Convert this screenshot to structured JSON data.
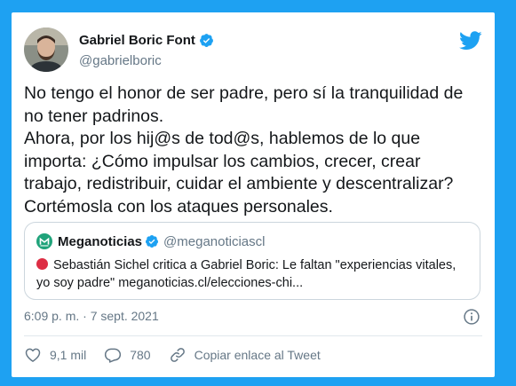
{
  "author": {
    "name": "Gabriel Boric Font",
    "handle": "@gabrielboric"
  },
  "tweet": {
    "lines": [
      "No tengo el honor de ser padre, pero sí la tranquilidad de",
      "no tener padrinos.",
      "Ahora, por los hij@s de tod@s, hablemos de lo que",
      "importa: ¿Cómo impulsar los cambios, crecer, crear",
      "trabajo, redistribuir, cuidar el ambiente y descentralizar?",
      "Cortémosla con los ataques personales."
    ]
  },
  "quote": {
    "name": "Meganoticias",
    "handle": "@meganoticiascl",
    "line1": "Sebastián Sichel critica a Gabriel Boric: Le faltan \"experiencias vitales,",
    "line2": "yo soy padre\" meganoticias.cl/elecciones-chi..."
  },
  "timestamp": "6:09 p. m. · 7 sept. 2021",
  "actions": {
    "likes": "9,1 mil",
    "replies": "780",
    "copy_link": "Copiar enlace al Tweet"
  },
  "colors": {
    "background": "#1ea1f2",
    "accent": "#1da1f2",
    "alert_dot": "#dd2e44"
  },
  "icons": [
    "verified-icon",
    "twitter-bird-icon",
    "info-icon",
    "heart-icon",
    "reply-icon",
    "link-icon",
    "meganoticias-logo-icon"
  ]
}
